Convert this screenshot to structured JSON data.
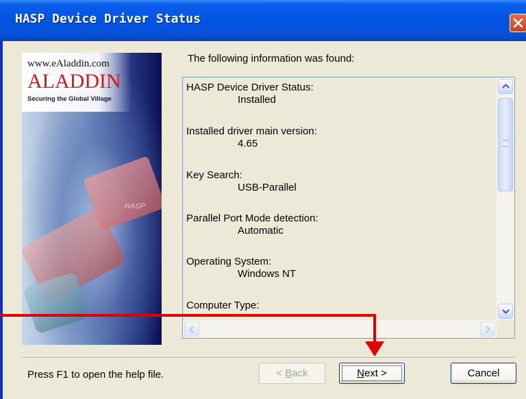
{
  "window": {
    "title": "HASP Device Driver Status"
  },
  "banner": {
    "url": "www.eAladdin.com",
    "logo": "ALADDIN",
    "tagline": "Securing the Global Village",
    "key_label": "HASP"
  },
  "main": {
    "info_label": "The following information was found:",
    "entries": [
      {
        "label": "HASP Device Driver Status:",
        "value": "Installed"
      },
      {
        "label": "Installed driver main version:",
        "value": "4.65"
      },
      {
        "label": "Key Search:",
        "value": "USB-Parallel"
      },
      {
        "label": "Parallel Port Mode detection:",
        "value": "Automatic"
      },
      {
        "label": "Operating System:",
        "value": "Windows NT"
      },
      {
        "label": "Computer Type:",
        "value": ""
      }
    ]
  },
  "footer": {
    "help_text": "Press F1 to open the help file.",
    "back_prefix": "< ",
    "back_mnemonic": "B",
    "back_rest": "ack",
    "next_mnemonic": "N",
    "next_rest": "ext >",
    "cancel_label": "Cancel"
  },
  "colors": {
    "title_bar": "#0054e3",
    "annotation_arrow": "#e00000"
  }
}
